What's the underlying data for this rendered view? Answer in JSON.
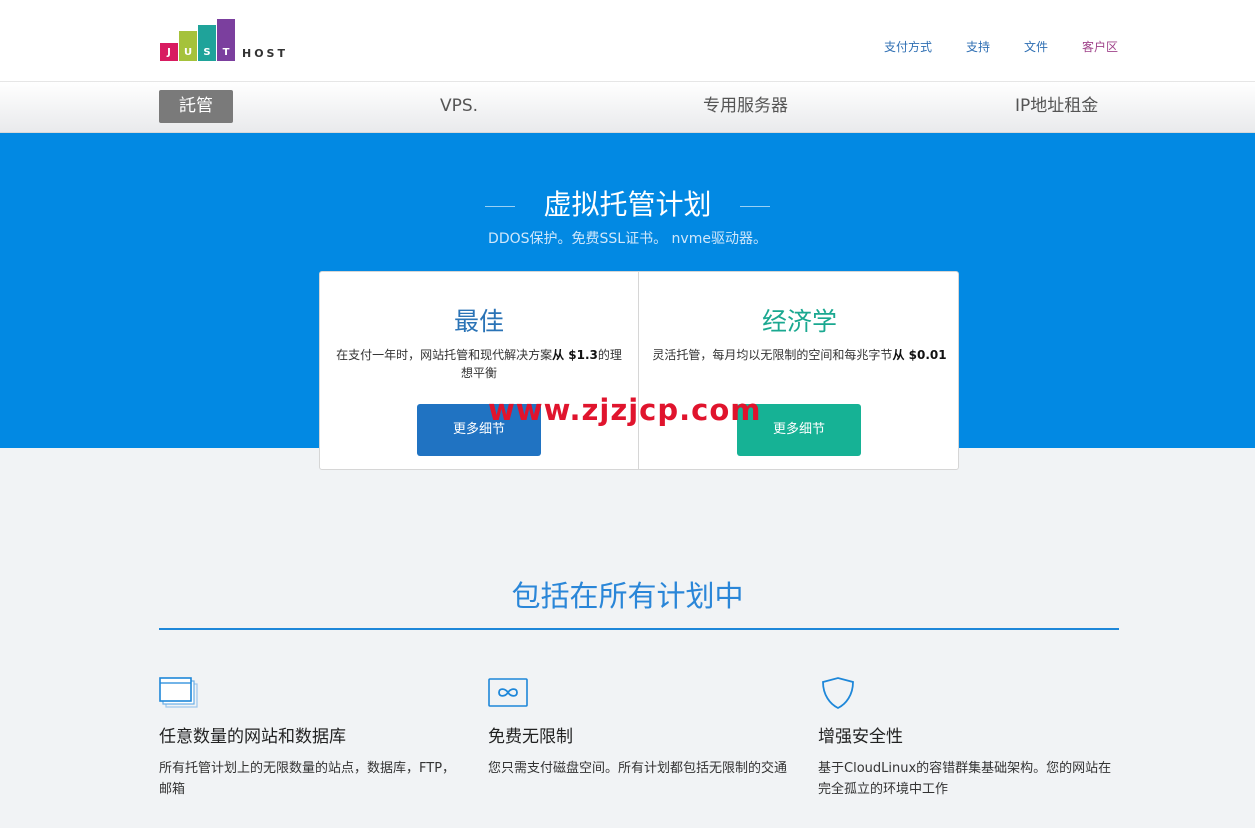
{
  "header": {
    "logo_letters": [
      "J",
      "U",
      "S",
      "T"
    ],
    "logo_host": "HOST",
    "nav": [
      {
        "label": "支付方式"
      },
      {
        "label": "支持"
      },
      {
        "label": "文件"
      },
      {
        "label": "客户区"
      }
    ]
  },
  "subnav": {
    "items": [
      {
        "label": "託管"
      },
      {
        "label": "VPS."
      },
      {
        "label": "专用服务器"
      },
      {
        "label": "IP地址租金"
      }
    ]
  },
  "hero": {
    "title": "虚拟托管计划",
    "subtitle": "DDOS保护。免费SSL证书。 nvme驱动器。"
  },
  "cards": [
    {
      "title": "最佳",
      "desc_prefix": "在支付一年时，网站托管和现代解决方案",
      "desc_bold": "从 $1.3",
      "desc_suffix": "的理想平衡",
      "button": "更多细节"
    },
    {
      "title": "经济学",
      "desc_prefix": "灵活托管，每月均以无限制的空间和每兆字节",
      "desc_bold": "从 $0.01",
      "desc_suffix": "",
      "button": "更多细节"
    }
  ],
  "watermark": "www.zjzjcp.com",
  "included": {
    "title": "包括在所有计划中",
    "features": [
      {
        "icon": "stacked-windows-icon",
        "title": "任意数量的网站和数据库",
        "desc": "所有托管计划上的无限数量的站点，数据库，FTP，邮箱"
      },
      {
        "icon": "infinity-icon",
        "title": "免费无限制",
        "desc": "您只需支付磁盘空间。所有计划都包括无限制的交通"
      },
      {
        "icon": "shield-icon",
        "title": "增强安全性",
        "desc": "基于CloudLinux的容错群集基础架构。您的网站在完全孤立的环境中工作"
      }
    ]
  },
  "colors": {
    "brand_blue": "#0289e3",
    "best_button": "#2073c2",
    "economy_button": "#16b295",
    "client_link": "#a0448b"
  }
}
